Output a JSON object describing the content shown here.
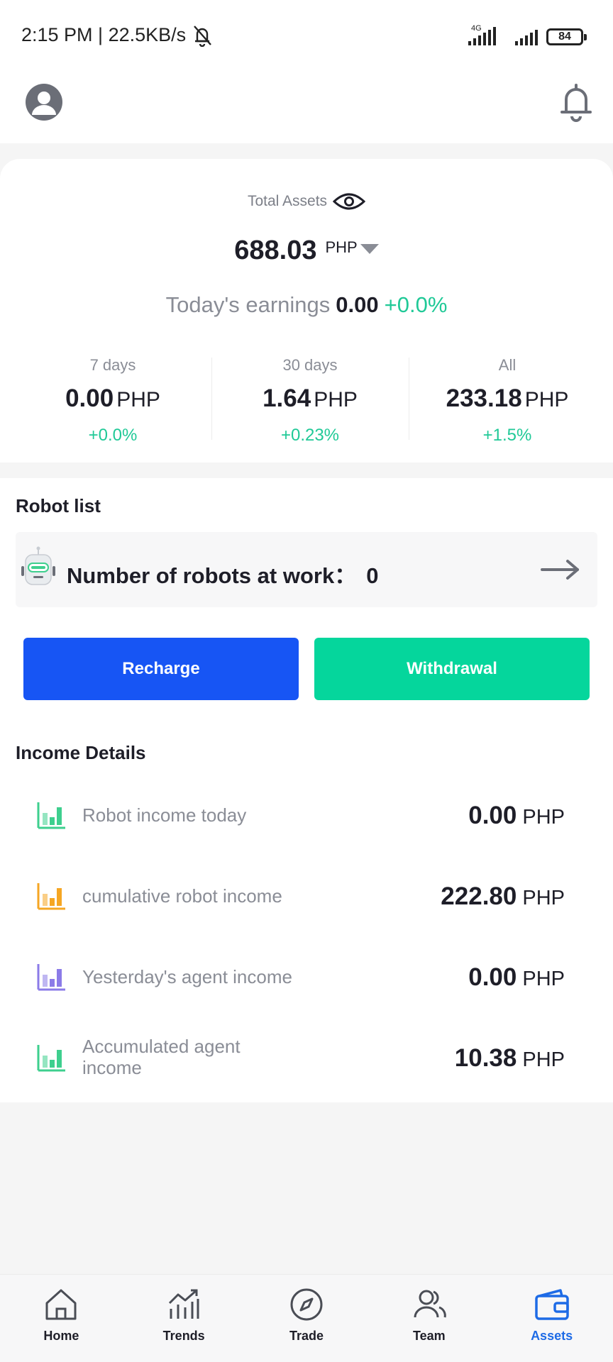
{
  "status_bar": {
    "time": "2:15 PM | 22.5KB/s",
    "network": "4G",
    "battery": "84"
  },
  "total_assets": {
    "label": "Total Assets",
    "value": "688.03",
    "unit": "PHP"
  },
  "today": {
    "label": "Today's earnings",
    "value": "0.00",
    "change": "+0.0%"
  },
  "periods": [
    {
      "label": "7 days",
      "value": "0.00",
      "unit": "PHP",
      "change": "+0.0%"
    },
    {
      "label": "30 days",
      "value": "1.64",
      "unit": "PHP",
      "change": "+0.23%"
    },
    {
      "label": "All",
      "value": "233.18",
      "unit": "PHP",
      "change": "+1.5%"
    }
  ],
  "robot_list": {
    "title": "Robot list",
    "label": "Number of robots at work：",
    "count": "0"
  },
  "buttons": {
    "recharge": "Recharge",
    "withdrawal": "Withdrawal"
  },
  "income": {
    "title": "Income Details",
    "items": [
      {
        "label": "Robot income today",
        "value": "0.00",
        "unit": "PHP",
        "icon": "bar-chart-icon",
        "color": "#3ecf8e"
      },
      {
        "label": "cumulative robot income",
        "value": "222.80",
        "unit": "PHP",
        "icon": "bar-chart-icon",
        "color": "#f5a623"
      },
      {
        "label": "Yesterday's agent income",
        "value": "0.00",
        "unit": "PHP",
        "icon": "bar-chart-icon",
        "color": "#8b7be8"
      },
      {
        "label": "Accumulated agent income",
        "value": "10.38",
        "unit": "PHP",
        "icon": "bar-chart-icon",
        "color": "#3ecf8e"
      }
    ]
  },
  "tabs": [
    {
      "label": "Home",
      "icon": "home-icon"
    },
    {
      "label": "Trends",
      "icon": "trends-icon"
    },
    {
      "label": "Trade",
      "icon": "compass-icon"
    },
    {
      "label": "Team",
      "icon": "team-icon"
    },
    {
      "label": "Assets",
      "icon": "wallet-icon",
      "active": true
    }
  ],
  "colors": {
    "accent_blue": "#1755f4",
    "accent_green": "#05d69c",
    "positive": "#20c997",
    "active_tab": "#1e6be6"
  }
}
